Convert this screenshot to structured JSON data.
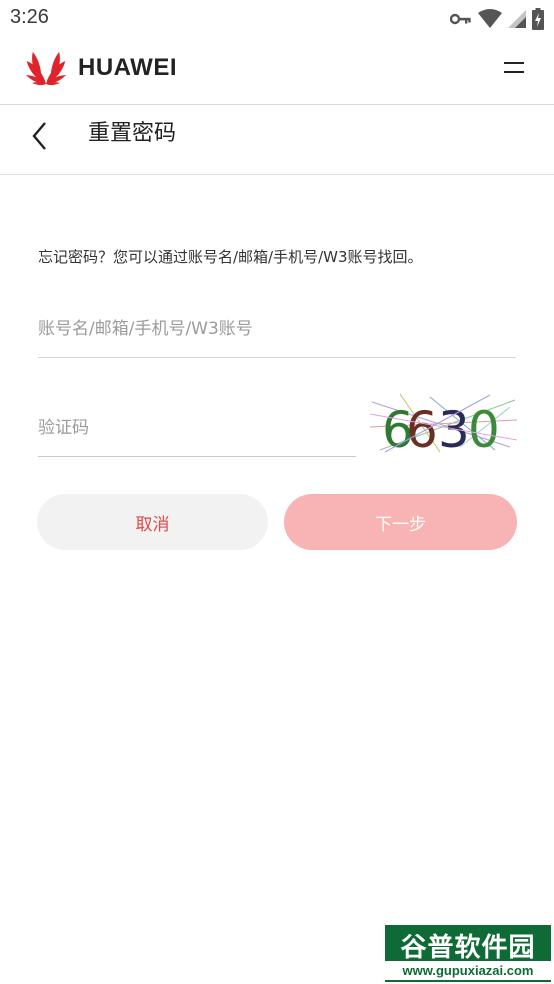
{
  "status_bar": {
    "time": "3:26",
    "icons": [
      "vpn-key-icon",
      "wifi-icon",
      "cell-signal-icon",
      "battery-charging-icon"
    ]
  },
  "header": {
    "brand_name": "HUAWEI",
    "logo_icon": "huawei-petal-logo",
    "menu_icon": "menu-icon",
    "brand_color": "#e0242c"
  },
  "title_bar": {
    "back_icon": "chevron-left-icon",
    "title": "重置密码"
  },
  "form": {
    "hint": "忘记密码？您可以通过账号名/邮箱/手机号/W3账号找回。",
    "account_field": {
      "placeholder": "账号名/邮箱/手机号/W3账号",
      "value": ""
    },
    "captcha_field": {
      "placeholder": "验证码",
      "value": ""
    },
    "captcha_image_text": "6630",
    "buttons": {
      "cancel_label": "取消",
      "next_label": "下一步"
    }
  },
  "watermark": {
    "brand": "谷普软件园",
    "url": "www.gupuxiazai.com"
  }
}
